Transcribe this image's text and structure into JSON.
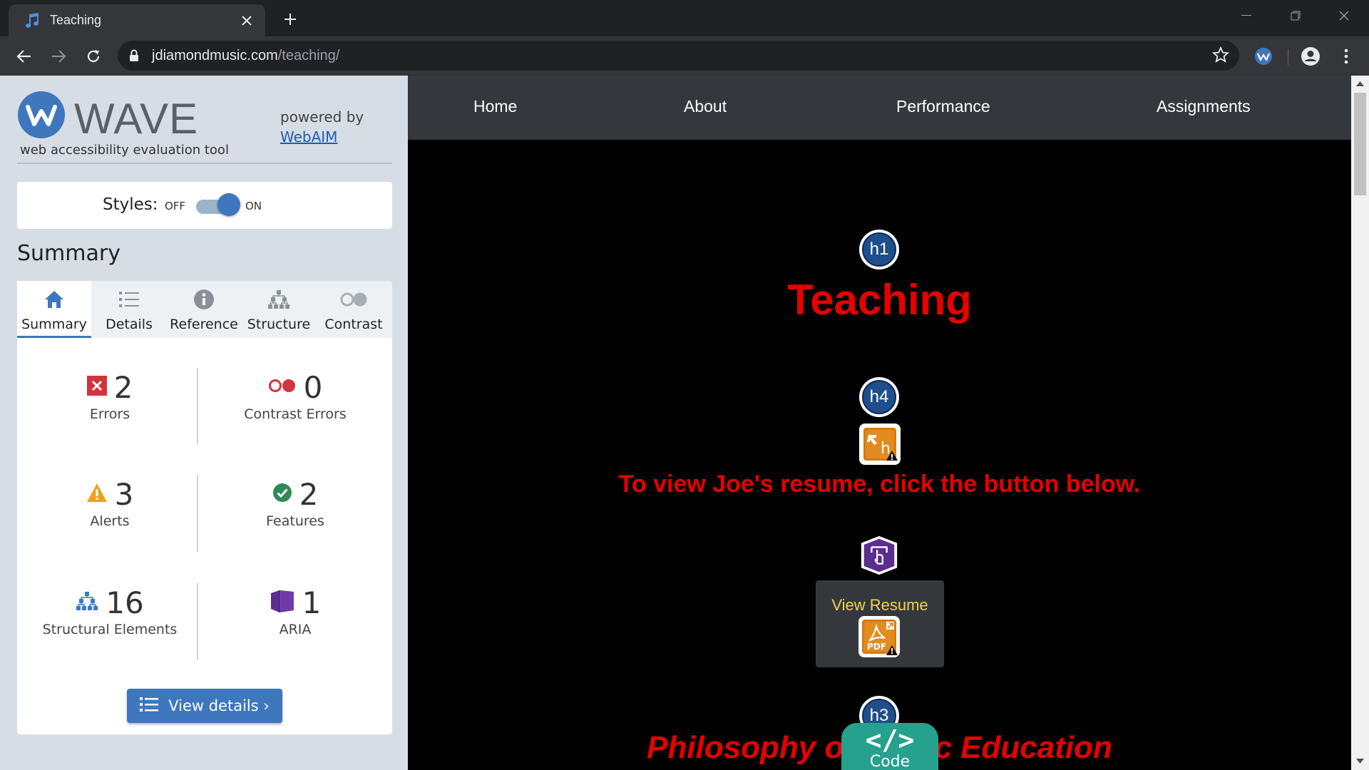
{
  "browser": {
    "tab_title": "Teaching",
    "url_host": "jdiamondmusic.com",
    "url_path": "/teaching/"
  },
  "wave": {
    "title": "WAVE",
    "subtitle": "web accessibility evaluation tool",
    "powered_by": "powered by",
    "webaim": "WebAIM",
    "styles_label": "Styles:",
    "styles_off": "OFF",
    "styles_on": "ON",
    "styles_state": "on",
    "summary_heading": "Summary",
    "tabs": [
      {
        "label": "Summary",
        "icon": "home-icon",
        "active": true
      },
      {
        "label": "Details",
        "icon": "list-icon",
        "active": false
      },
      {
        "label": "Reference",
        "icon": "info-icon",
        "active": false
      },
      {
        "label": "Structure",
        "icon": "hierarchy-icon",
        "active": false
      },
      {
        "label": "Contrast",
        "icon": "contrast-icon",
        "active": false
      }
    ],
    "stats": {
      "errors": {
        "count": "2",
        "label": "Errors"
      },
      "contrast_errors": {
        "count": "0",
        "label": "Contrast Errors"
      },
      "alerts": {
        "count": "3",
        "label": "Alerts"
      },
      "features": {
        "count": "2",
        "label": "Features"
      },
      "structural": {
        "count": "16",
        "label": "Structural Elements"
      },
      "aria": {
        "count": "1",
        "label": "ARIA"
      }
    },
    "view_details": "View details ›"
  },
  "site": {
    "nav": [
      "Home",
      "About",
      "Performance",
      "Assignments"
    ],
    "h1": "Teaching",
    "h4": "To view Joe's resume, click the button below.",
    "resume_button": "View Resume",
    "h3": "Philosophy of Music Education",
    "badges": {
      "h1": "h1",
      "h4": "h4",
      "h3": "h3"
    },
    "code_label": "Code",
    "code_glyph": "</>"
  },
  "colors": {
    "wave_blue": "#3e77be",
    "heading_red": "#e60000",
    "resume_yellow": "#f3d34a",
    "code_teal": "#25a18e"
  }
}
